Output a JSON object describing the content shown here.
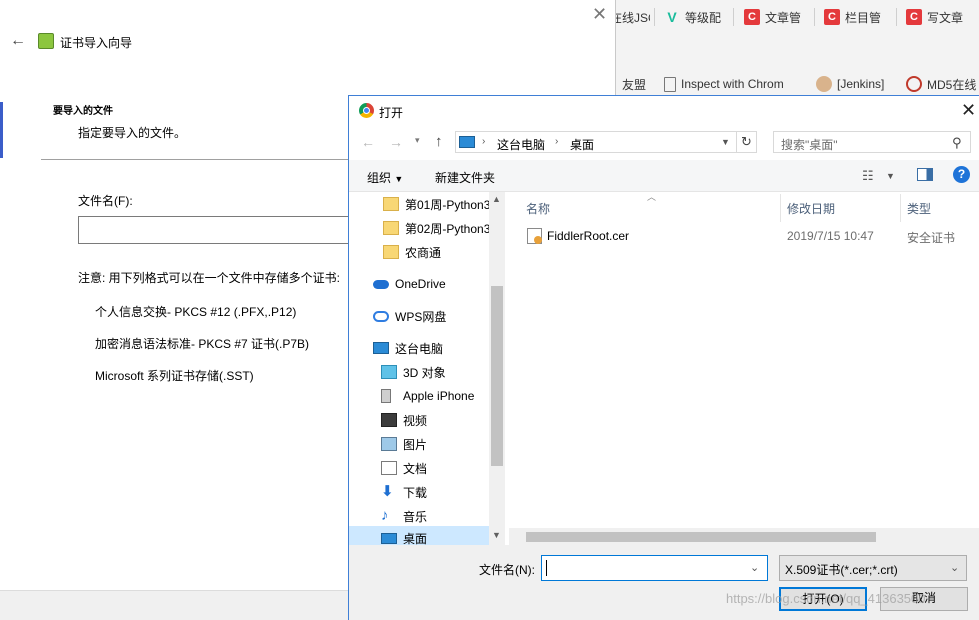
{
  "browser": {
    "bookmarks_row1": [
      {
        "label": "在线JSON",
        "icon": "page-icon"
      },
      {
        "label": "等级配",
        "icon": "vue-icon"
      },
      {
        "label": "文章管",
        "icon": "csdn-icon"
      },
      {
        "label": "栏目管",
        "icon": "csdn-icon"
      },
      {
        "label": "写文章",
        "icon": "csdn-icon"
      }
    ],
    "bookmarks_row2": [
      {
        "label": "友盟",
        "icon": "none"
      },
      {
        "label": "Inspect with Chrom",
        "icon": "page-icon"
      },
      {
        "label": "[Jenkins]",
        "icon": "jenkins-icon"
      },
      {
        "label": "MD5在线",
        "icon": "md5-icon"
      }
    ]
  },
  "wizard": {
    "title": "证书导入向导",
    "section_title": "要导入的文件",
    "section_subtitle": "指定要导入的文件。",
    "filename_label": "文件名(F):",
    "note": "注意: 用下列格式可以在一个文件中存储多个证书:",
    "formats": [
      "个人信息交换- PKCS #12 (.PFX,.P12)",
      "加密消息语法标准- PKCS #7 证书(.P7B)",
      "Microsoft 系列证书存储(.SST)"
    ]
  },
  "dialog": {
    "title": "打开",
    "breadcrumb": [
      "这台电脑",
      "桌面"
    ],
    "search_placeholder": "搜索\"桌面\"",
    "toolbar": {
      "organize": "组织",
      "new_folder": "新建文件夹"
    },
    "nav_items": [
      {
        "label": "第01周-Python3",
        "icon": "folder-icon"
      },
      {
        "label": "第02周-Python3",
        "icon": "folder-icon"
      },
      {
        "label": "农商通",
        "icon": "folder-icon"
      },
      {
        "label": "OneDrive",
        "icon": "onedrive-icon"
      },
      {
        "label": "WPS网盘",
        "icon": "wps-cloud-icon"
      },
      {
        "label": "这台电脑",
        "icon": "computer-icon"
      },
      {
        "label": "3D 对象",
        "icon": "3d-objects-icon"
      },
      {
        "label": "Apple iPhone",
        "icon": "iphone-icon"
      },
      {
        "label": "视频",
        "icon": "video-icon"
      },
      {
        "label": "图片",
        "icon": "pictures-icon"
      },
      {
        "label": "文档",
        "icon": "documents-icon"
      },
      {
        "label": "下载",
        "icon": "downloads-icon"
      },
      {
        "label": "音乐",
        "icon": "music-icon"
      },
      {
        "label": "桌面",
        "icon": "desktop-icon"
      }
    ],
    "columns": {
      "name": "名称",
      "date": "修改日期",
      "type": "类型"
    },
    "files": [
      {
        "name": "FiddlerRoot.cer",
        "date": "2019/7/15 10:47",
        "type": "安全证书"
      }
    ],
    "filename_label": "文件名(N):",
    "filename_value": "",
    "filetype": "X.509证书(*.cer;*.crt)",
    "open_button": "打开(O)",
    "cancel_button": "取消",
    "watermark": "https://blog.csdn.net/qq_41363500"
  }
}
